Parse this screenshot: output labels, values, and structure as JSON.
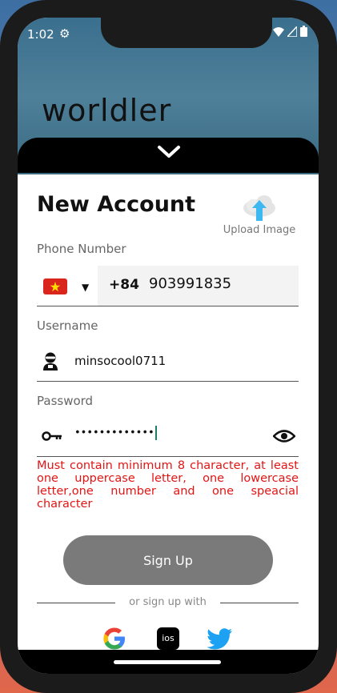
{
  "status": {
    "time": "1:02"
  },
  "app": {
    "logo": "worldler"
  },
  "form": {
    "title": "New Account",
    "upload_label": "Upload Image",
    "phone_label": "Phone Number",
    "country_code": "+84",
    "phone_value": "903991835",
    "username_label": "Username",
    "username_value": "minsocool0711",
    "password_label": "Password",
    "password_masked": "•••••••••••••",
    "password_error": "Must contain minimum 8 character, at least one uppercase letter, one lowercase letter,one number and one speacial character",
    "signup_label": "Sign Up",
    "divider_text": "or sign up with"
  },
  "social": {
    "ios_label": "iOS"
  },
  "colors": {
    "error": "#e21515",
    "button": "#7a7a7a",
    "sheet": "#000000",
    "header": "#3a6f8e"
  }
}
